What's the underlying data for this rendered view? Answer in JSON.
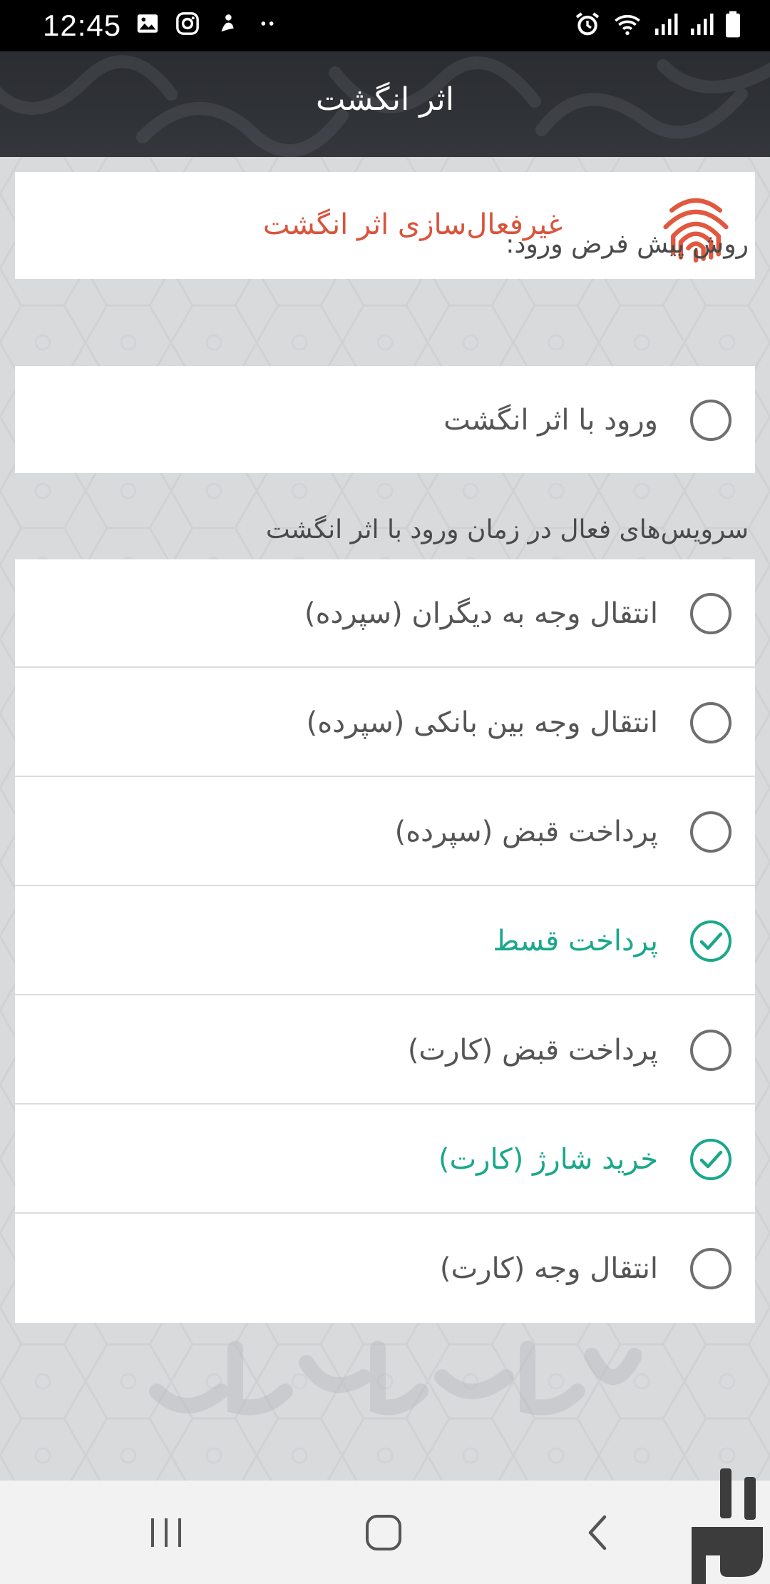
{
  "status_bar": {
    "time": "12:45",
    "left_icons": [
      "image-icon",
      "instagram-icon",
      "notification-icon",
      "more-dots-icon"
    ],
    "right_icons": [
      "alarm-icon",
      "wifi-icon",
      "signal-icon",
      "signal-icon",
      "battery-icon"
    ]
  },
  "header": {
    "title": "اثر انگشت"
  },
  "disable_fingerprint": {
    "label": "غیرفعال‌سازی اثر انگشت",
    "icon": "fingerprint-icon",
    "color": "#d9543c"
  },
  "login_section": {
    "title": "روش پیش فرض ورود:",
    "option": {
      "label": "ورود با اثر انگشت",
      "checked": false
    }
  },
  "services_section": {
    "title": "سرویس‌های فعال در زمان ورود با اثر انگشت",
    "items": [
      {
        "label": "انتقال وجه به دیگران (سپرده)",
        "checked": false
      },
      {
        "label": "انتقال وجه بین بانکی (سپرده)",
        "checked": false
      },
      {
        "label": "پرداخت قبض (سپرده)",
        "checked": false
      },
      {
        "label": "پرداخت قسط",
        "checked": true
      },
      {
        "label": "پرداخت قبض (کارت)",
        "checked": false
      },
      {
        "label": "خرید شارژ (کارت)",
        "checked": true
      },
      {
        "label": "انتقال وجه (کارت)",
        "checked": false
      }
    ]
  },
  "colors": {
    "accent_checked": "#1aa88a",
    "header_bg": "#2f3237",
    "danger": "#d9543c"
  },
  "nav_bar": {
    "buttons": [
      "recent-apps-icon",
      "home-icon",
      "back-icon"
    ]
  }
}
